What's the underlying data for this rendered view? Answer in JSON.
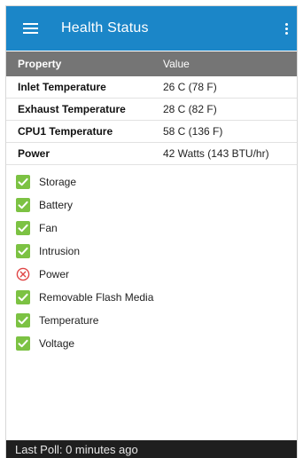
{
  "app": {
    "title": "Health Status"
  },
  "colors": {
    "appbar": "#1b86c8",
    "table_header": "#757575",
    "ok_green": "#7cc243",
    "error_red": "#e04545",
    "footer": "#1f1f1f"
  },
  "table": {
    "headers": {
      "property": "Property",
      "value": "Value"
    },
    "rows": [
      {
        "property": "Inlet Temperature",
        "value": "26 C (78 F)"
      },
      {
        "property": "Exhaust Temperature",
        "value": "28 C (82 F)"
      },
      {
        "property": "CPU1 Temperature",
        "value": "58 C (136 F)"
      },
      {
        "property": "Power",
        "value": "42 Watts (143 BTU/hr)"
      }
    ]
  },
  "status_items": [
    {
      "label": "Storage",
      "icon": "check-icon",
      "status": "ok"
    },
    {
      "label": "Battery",
      "icon": "check-icon",
      "status": "ok"
    },
    {
      "label": "Fan",
      "icon": "check-icon",
      "status": "ok"
    },
    {
      "label": "Intrusion",
      "icon": "check-icon",
      "status": "ok"
    },
    {
      "label": "Power",
      "icon": "error-x-icon",
      "status": "error"
    },
    {
      "label": "Removable Flash Media",
      "icon": "check-icon",
      "status": "ok"
    },
    {
      "label": "Temperature",
      "icon": "check-icon",
      "status": "ok"
    },
    {
      "label": "Voltage",
      "icon": "check-icon",
      "status": "ok"
    }
  ],
  "footer": {
    "last_poll": "Last Poll: 0 minutes ago"
  }
}
